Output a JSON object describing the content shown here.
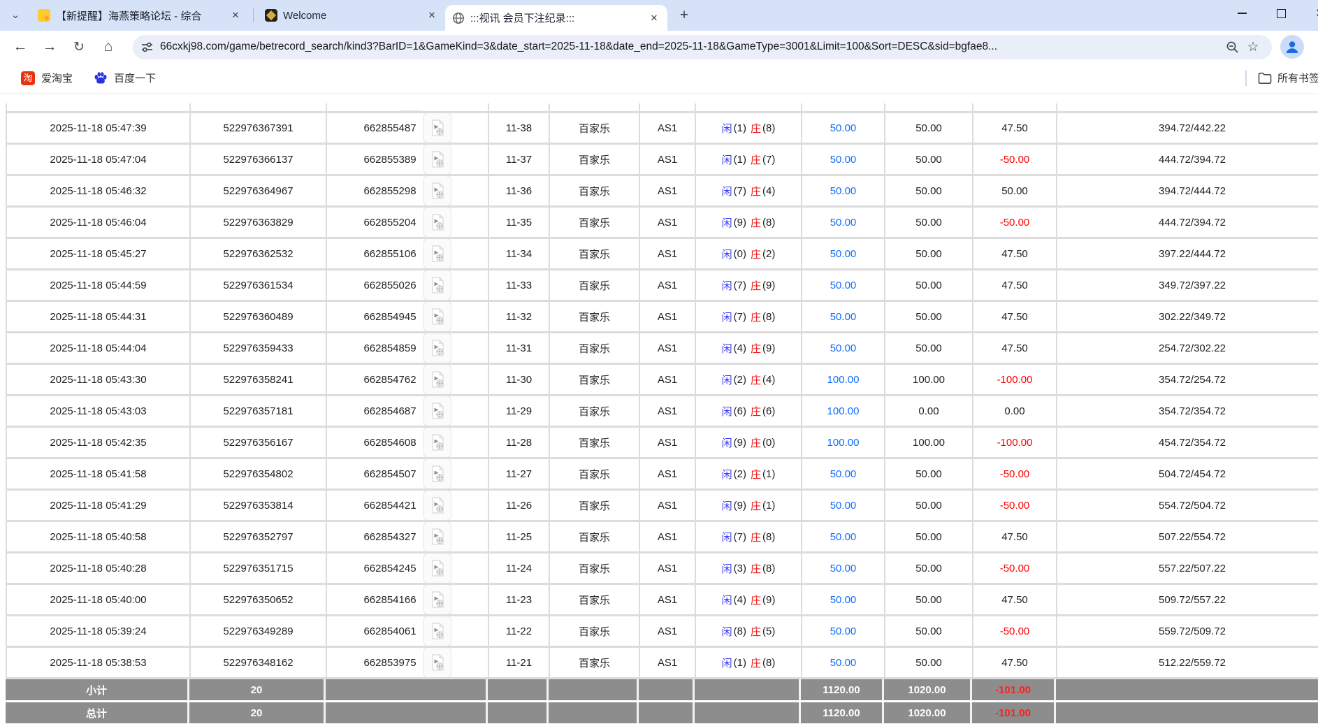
{
  "browser": {
    "tabs": [
      {
        "title": "【新提醒】海燕策略论坛 - 综合",
        "icon": "forum-icon"
      },
      {
        "title": "Welcome",
        "icon": "dragon-icon"
      },
      {
        "title": ":::视讯 会员下注纪录:::",
        "icon": "globe-icon",
        "active": true
      }
    ],
    "url": "66cxkj98.com/game/betrecord_search/kind3?BarID=1&GameKind=3&date_start=2025-11-18&date_end=2025-11-18&GameType=3001&Limit=100&Sort=DESC&sid=bgfae8...",
    "bookmarks": [
      {
        "label": "爱淘宝",
        "icon": "taobao-icon",
        "icon_glyph": "淘"
      },
      {
        "label": "百度一下",
        "icon": "baidu-paw-icon"
      }
    ],
    "all_bookmarks_label": "所有书签"
  },
  "table": {
    "bet_labels": {
      "player": "闲",
      "banker": "庄"
    },
    "rows": [
      {
        "time": "2025-11-18 05:47:39",
        "bet_id": "522976367391",
        "game_id": "662855487",
        "round": "11-38",
        "game": "百家乐",
        "table": "AS1",
        "player": "1",
        "banker": "8",
        "amount": "50.00",
        "valid": "50.00",
        "result": "47.50",
        "balance": "394.72/442.22"
      },
      {
        "time": "2025-11-18 05:47:04",
        "bet_id": "522976366137",
        "game_id": "662855389",
        "round": "11-37",
        "game": "百家乐",
        "table": "AS1",
        "player": "1",
        "banker": "7",
        "amount": "50.00",
        "valid": "50.00",
        "result": "-50.00",
        "balance": "444.72/394.72"
      },
      {
        "time": "2025-11-18 05:46:32",
        "bet_id": "522976364967",
        "game_id": "662855298",
        "round": "11-36",
        "game": "百家乐",
        "table": "AS1",
        "player": "7",
        "banker": "4",
        "amount": "50.00",
        "valid": "50.00",
        "result": "50.00",
        "balance": "394.72/444.72"
      },
      {
        "time": "2025-11-18 05:46:04",
        "bet_id": "522976363829",
        "game_id": "662855204",
        "round": "11-35",
        "game": "百家乐",
        "table": "AS1",
        "player": "9",
        "banker": "8",
        "amount": "50.00",
        "valid": "50.00",
        "result": "-50.00",
        "balance": "444.72/394.72"
      },
      {
        "time": "2025-11-18 05:45:27",
        "bet_id": "522976362532",
        "game_id": "662855106",
        "round": "11-34",
        "game": "百家乐",
        "table": "AS1",
        "player": "0",
        "banker": "2",
        "amount": "50.00",
        "valid": "50.00",
        "result": "47.50",
        "balance": "397.22/444.72"
      },
      {
        "time": "2025-11-18 05:44:59",
        "bet_id": "522976361534",
        "game_id": "662855026",
        "round": "11-33",
        "game": "百家乐",
        "table": "AS1",
        "player": "7",
        "banker": "9",
        "amount": "50.00",
        "valid": "50.00",
        "result": "47.50",
        "balance": "349.72/397.22"
      },
      {
        "time": "2025-11-18 05:44:31",
        "bet_id": "522976360489",
        "game_id": "662854945",
        "round": "11-32",
        "game": "百家乐",
        "table": "AS1",
        "player": "7",
        "banker": "8",
        "amount": "50.00",
        "valid": "50.00",
        "result": "47.50",
        "balance": "302.22/349.72"
      },
      {
        "time": "2025-11-18 05:44:04",
        "bet_id": "522976359433",
        "game_id": "662854859",
        "round": "11-31",
        "game": "百家乐",
        "table": "AS1",
        "player": "4",
        "banker": "9",
        "amount": "50.00",
        "valid": "50.00",
        "result": "47.50",
        "balance": "254.72/302.22"
      },
      {
        "time": "2025-11-18 05:43:30",
        "bet_id": "522976358241",
        "game_id": "662854762",
        "round": "11-30",
        "game": "百家乐",
        "table": "AS1",
        "player": "2",
        "banker": "4",
        "amount": "100.00",
        "valid": "100.00",
        "result": "-100.00",
        "balance": "354.72/254.72"
      },
      {
        "time": "2025-11-18 05:43:03",
        "bet_id": "522976357181",
        "game_id": "662854687",
        "round": "11-29",
        "game": "百家乐",
        "table": "AS1",
        "player": "6",
        "banker": "6",
        "amount": "100.00",
        "valid": "0.00",
        "result": "0.00",
        "balance": "354.72/354.72"
      },
      {
        "time": "2025-11-18 05:42:35",
        "bet_id": "522976356167",
        "game_id": "662854608",
        "round": "11-28",
        "game": "百家乐",
        "table": "AS1",
        "player": "9",
        "banker": "0",
        "amount": "100.00",
        "valid": "100.00",
        "result": "-100.00",
        "balance": "454.72/354.72"
      },
      {
        "time": "2025-11-18 05:41:58",
        "bet_id": "522976354802",
        "game_id": "662854507",
        "round": "11-27",
        "game": "百家乐",
        "table": "AS1",
        "player": "2",
        "banker": "1",
        "amount": "50.00",
        "valid": "50.00",
        "result": "-50.00",
        "balance": "504.72/454.72"
      },
      {
        "time": "2025-11-18 05:41:29",
        "bet_id": "522976353814",
        "game_id": "662854421",
        "round": "11-26",
        "game": "百家乐",
        "table": "AS1",
        "player": "9",
        "banker": "1",
        "amount": "50.00",
        "valid": "50.00",
        "result": "-50.00",
        "balance": "554.72/504.72"
      },
      {
        "time": "2025-11-18 05:40:58",
        "bet_id": "522976352797",
        "game_id": "662854327",
        "round": "11-25",
        "game": "百家乐",
        "table": "AS1",
        "player": "7",
        "banker": "8",
        "amount": "50.00",
        "valid": "50.00",
        "result": "47.50",
        "balance": "507.22/554.72"
      },
      {
        "time": "2025-11-18 05:40:28",
        "bet_id": "522976351715",
        "game_id": "662854245",
        "round": "11-24",
        "game": "百家乐",
        "table": "AS1",
        "player": "3",
        "banker": "8",
        "amount": "50.00",
        "valid": "50.00",
        "result": "-50.00",
        "balance": "557.22/507.22"
      },
      {
        "time": "2025-11-18 05:40:00",
        "bet_id": "522976350652",
        "game_id": "662854166",
        "round": "11-23",
        "game": "百家乐",
        "table": "AS1",
        "player": "4",
        "banker": "9",
        "amount": "50.00",
        "valid": "50.00",
        "result": "47.50",
        "balance": "509.72/557.22"
      },
      {
        "time": "2025-11-18 05:39:24",
        "bet_id": "522976349289",
        "game_id": "662854061",
        "round": "11-22",
        "game": "百家乐",
        "table": "AS1",
        "player": "8",
        "banker": "5",
        "amount": "50.00",
        "valid": "50.00",
        "result": "-50.00",
        "balance": "559.72/509.72"
      },
      {
        "time": "2025-11-18 05:38:53",
        "bet_id": "522976348162",
        "game_id": "662853975",
        "round": "11-21",
        "game": "百家乐",
        "table": "AS1",
        "player": "1",
        "banker": "8",
        "amount": "50.00",
        "valid": "50.00",
        "result": "47.50",
        "balance": "512.22/559.72"
      }
    ],
    "subtotal": {
      "label": "小计",
      "count": "20",
      "amount": "1120.00",
      "valid": "1020.00",
      "winloss": "-101.00"
    },
    "total": {
      "label": "总计",
      "count": "20",
      "amount": "1120.00",
      "valid": "1020.00",
      "winloss": "-101.00"
    }
  },
  "colors": {
    "amount_blue": "#0f6eff",
    "player_blue": "#3a3af0",
    "banker_red": "#f01414",
    "negative_red": "#ff0000",
    "summary_bg": "#8d8d8d",
    "tabstrip_bg": "#d5e2f7"
  }
}
